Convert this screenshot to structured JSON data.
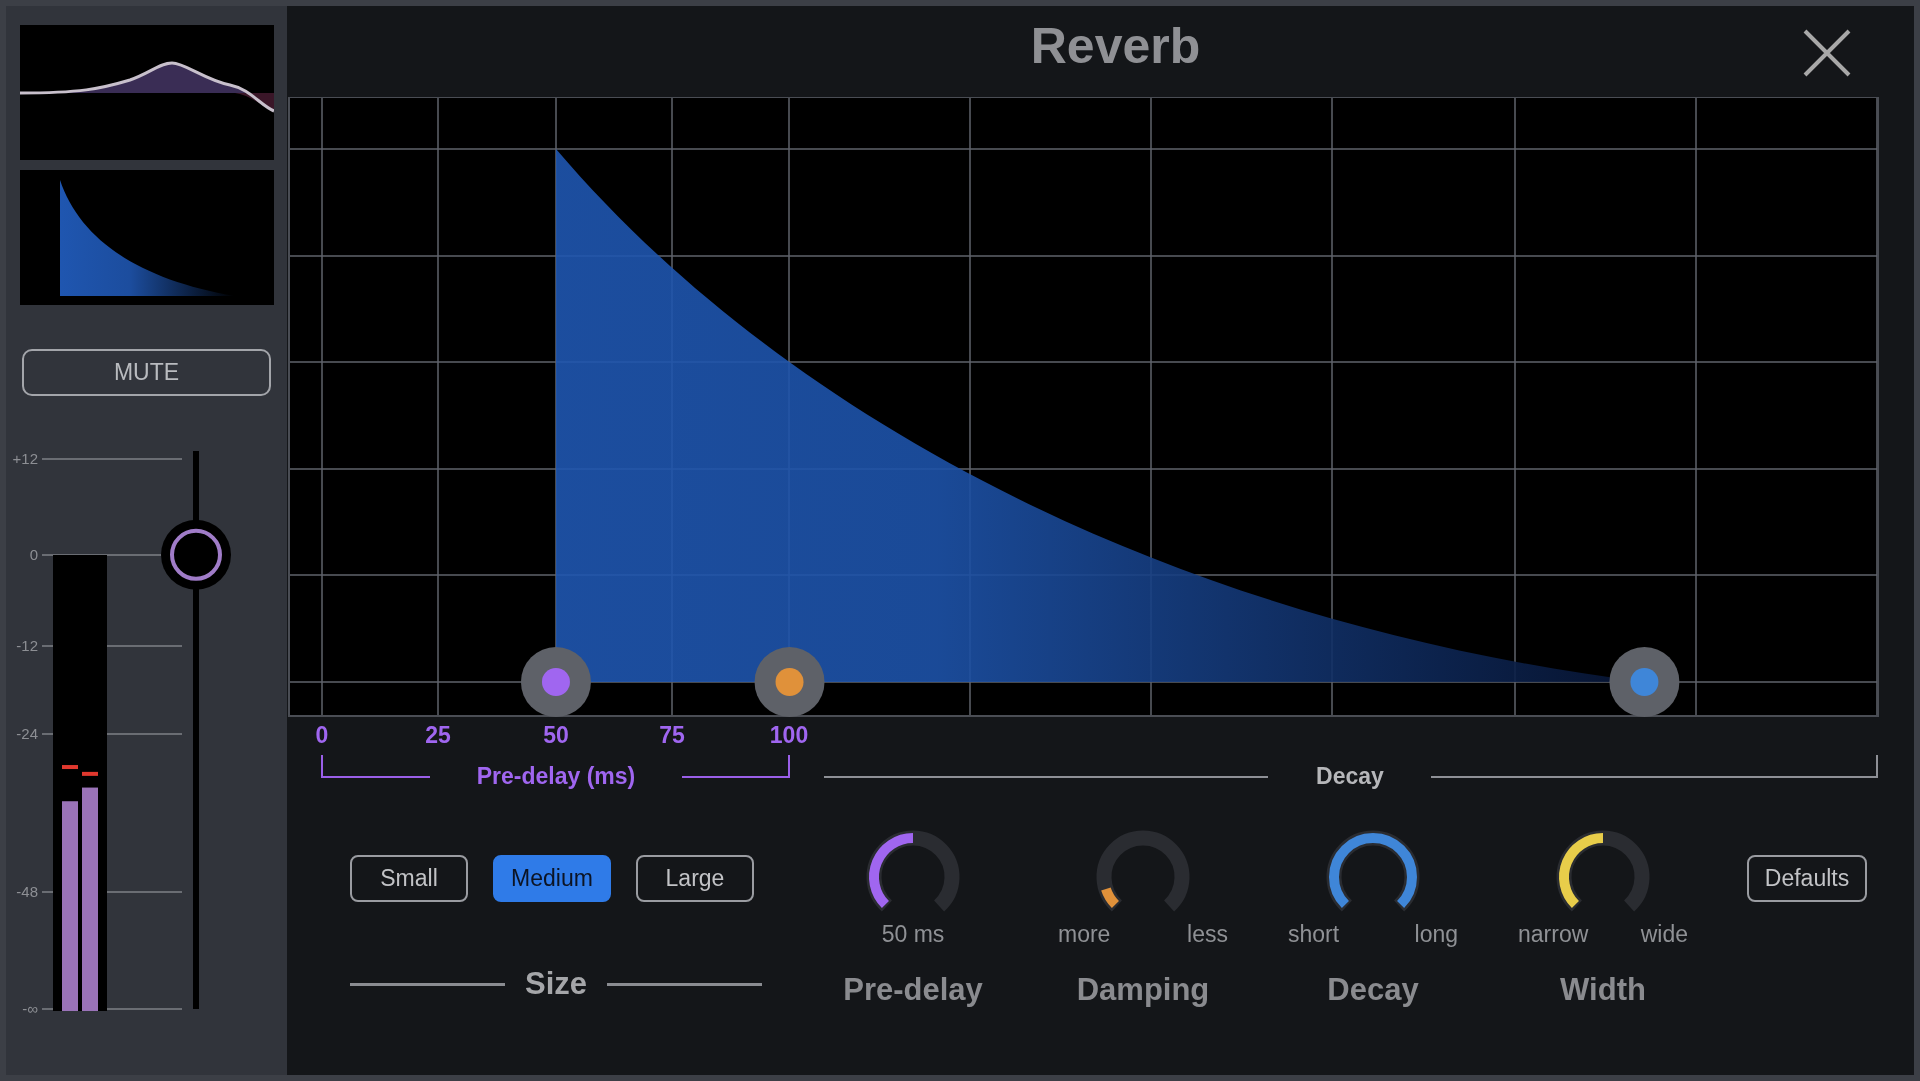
{
  "title": "Reverb",
  "sidebar": {
    "mute_button": "MUTE",
    "scale": [
      "+12",
      "0",
      "-12",
      "-24",
      "-48",
      "-∞"
    ],
    "meters": [
      {
        "level": 0.46,
        "peak": {
          "level": 0.535
        }
      },
      {
        "level": 0.49,
        "peak": {
          "level": 0.52
        }
      }
    ],
    "fader": {
      "level": 0.814
    }
  },
  "graph": {
    "handles": [
      {
        "color": "#a066f0",
        "level": 0.168
      },
      {
        "color": "#e0913a",
        "level": 0.315
      },
      {
        "color": "#3f86d8",
        "level": 0.853
      }
    ],
    "predelay_ticks": [
      "0",
      "25",
      "50",
      "75",
      "100"
    ],
    "predelay_label": "Pre-delay (ms)",
    "decay_label": "Decay"
  },
  "size": {
    "options": [
      {
        "label": "Small",
        "selected": false
      },
      {
        "label": "Medium",
        "selected": true
      },
      {
        "label": "Large",
        "selected": false
      }
    ],
    "label": "Size"
  },
  "knobs": [
    {
      "kind": "readout",
      "name": "Pre-delay",
      "level": 0.5,
      "color": "#a066f0",
      "readout": "50 ms"
    },
    {
      "kind": "range",
      "name": "Damping",
      "level": 0.1,
      "color": "#e0913a",
      "min_label": "more",
      "max_label": "less"
    },
    {
      "kind": "range",
      "name": "Decay",
      "level": 1,
      "color": "#3f86d8",
      "min_label": "short",
      "max_label": "long"
    },
    {
      "kind": "range",
      "name": "Width",
      "level": 0.5,
      "color": "#e8cd4a",
      "min_label": "narrow",
      "max_label": "wide"
    }
  ],
  "defaults_button": "Defaults"
}
